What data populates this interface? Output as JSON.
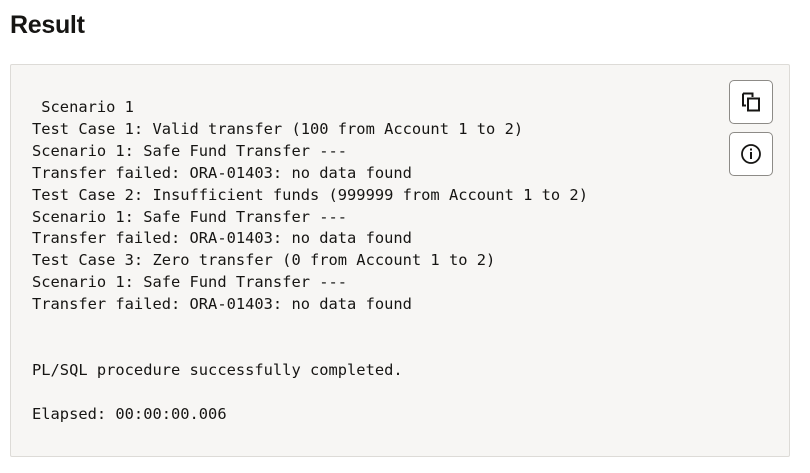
{
  "header": {
    "title": "Result"
  },
  "result": {
    "lines": [
      " Scenario 1",
      "Test Case 1: Valid transfer (100 from Account 1 to 2)",
      "Scenario 1: Safe Fund Transfer ---",
      "Transfer failed: ORA-01403: no data found",
      "Test Case 2: Insufficient funds (999999 from Account 1 to 2)",
      "Scenario 1: Safe Fund Transfer ---",
      "Transfer failed: ORA-01403: no data found",
      "Test Case 3: Zero transfer (0 from Account 1 to 2)",
      "Scenario 1: Safe Fund Transfer ---",
      "Transfer failed: ORA-01403: no data found",
      "",
      "",
      "PL/SQL procedure successfully completed.",
      "",
      "Elapsed: 00:00:00.006"
    ]
  },
  "actions": {
    "copy_icon": "copy-icon",
    "info_icon": "info-icon"
  },
  "colors": {
    "text": "#161513",
    "panel_background": "#f7f6f4",
    "panel_border": "#dddbd7",
    "button_border": "#8d8b87"
  }
}
